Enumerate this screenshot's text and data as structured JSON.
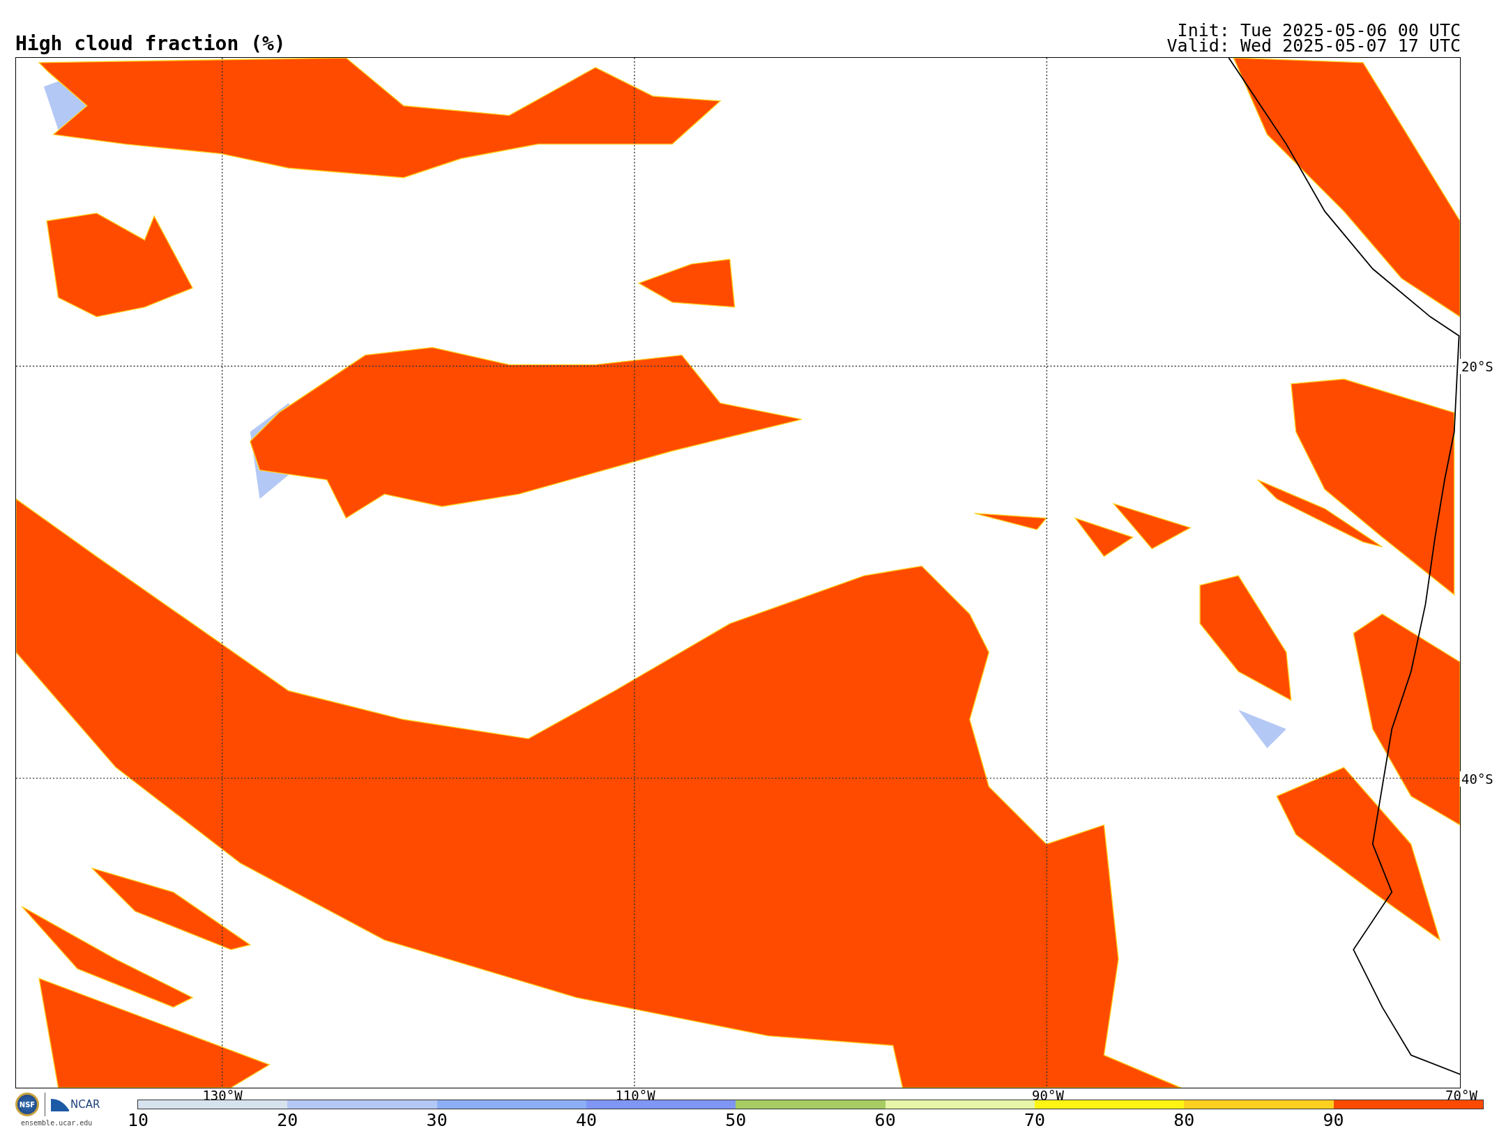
{
  "title": "High cloud fraction (%)",
  "init": "Init: Tue 2025-05-06 00 UTC",
  "valid": "Valid: Wed 2025-05-07 17 UTC",
  "map": {
    "lat_labels": [
      "20°S",
      "40°S"
    ],
    "lon_labels": [
      "130°W",
      "110°W",
      "90°W",
      "70°W"
    ]
  },
  "logos": {
    "nsf": "NSF",
    "ncar": "NCAR",
    "site": "ensemble.ucar.edu"
  },
  "colorbar": {
    "segments": [
      {
        "label": "10",
        "color": "#d6e2ed"
      },
      {
        "label": "20",
        "color": "#b4c8f5"
      },
      {
        "label": "30",
        "color": "#8caff5"
      },
      {
        "label": "40",
        "color": "#7f96f5"
      },
      {
        "label": "50",
        "color": "#a6cc63"
      },
      {
        "label": "60",
        "color": "#e6f5a8"
      },
      {
        "label": "70",
        "color": "#fff514"
      },
      {
        "label": "80",
        "color": "#ffd020"
      },
      {
        "label": "90",
        "color": "#ff4b00"
      }
    ]
  }
}
